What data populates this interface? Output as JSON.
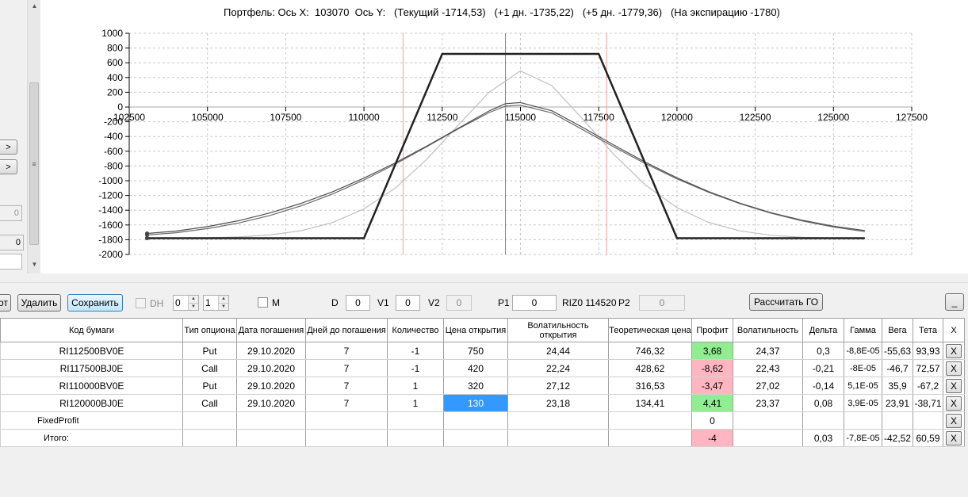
{
  "left_panel": {
    "btn1": ">",
    "btn2": ">",
    "field1": "0",
    "field2": "0",
    "scroll_grip": "≡"
  },
  "chart": {
    "title": "Портфель: Ось X:  103070  Ось Y:   (Текущий -1714,53)   (+1 дн. -1735,22)   (+5 дн. -1779,36)   (На экспирацию -1780)"
  },
  "chart_data": {
    "type": "line",
    "title": "Портфель: Ось X:  103070  Ось Y:   (Текущий -1714,53)   (+1 дн. -1735,22)   (+5 дн. -1779,36)   (На экспирацию -1780)",
    "x_ticks": [
      102500,
      105000,
      107500,
      110000,
      112500,
      115000,
      117500,
      120000,
      122500,
      125000,
      127500
    ],
    "y_ticks": [
      1000,
      800,
      600,
      400,
      200,
      0,
      -200,
      -400,
      -600,
      -800,
      -1000,
      -1200,
      -1400,
      -1600,
      -1800,
      -2000
    ],
    "xlim": [
      102500,
      127500
    ],
    "ylim": [
      -2000,
      1000
    ],
    "grid": true,
    "vertical_lines": [
      {
        "x": 111250,
        "color": "#ff9999"
      },
      {
        "x": 114520,
        "color": "#6b80c0"
      },
      {
        "x": 117750,
        "color": "#ff9999"
      }
    ],
    "series": [
      {
        "color": "#222222",
        "width": 2.5,
        "x": [
          103070,
          110000,
          112500,
          117500,
          120000,
          126000
        ],
        "y": [
          -1780,
          -1780,
          720,
          720,
          -1780,
          -1780
        ]
      },
      {
        "color": "#505050",
        "width": 1.2,
        "x": [
          103070,
          104000,
          105000,
          106000,
          107000,
          108000,
          109000,
          110000,
          111000,
          112000,
          113000,
          114000,
          114520,
          115000,
          116000,
          117000,
          118000,
          119000,
          120000,
          121000,
          122000,
          123000,
          124000,
          125000,
          126000
        ],
        "y": [
          -1715,
          -1683,
          -1623,
          -1542,
          -1437,
          -1306,
          -1149,
          -965,
          -758,
          -531,
          -293,
          -53,
          45,
          60,
          -50,
          -280,
          -520,
          -750,
          -960,
          -1145,
          -1303,
          -1433,
          -1536,
          -1616,
          -1676
        ]
      },
      {
        "color": "#6a6a6a",
        "width": 1.2,
        "x": [
          103070,
          104000,
          105000,
          106000,
          107000,
          108000,
          109000,
          110000,
          111000,
          112000,
          113000,
          114000,
          114520,
          115000,
          116000,
          117000,
          118000,
          119000,
          120000,
          121000,
          122000,
          123000,
          124000,
          125000,
          126000
        ],
        "y": [
          -1735,
          -1705,
          -1650,
          -1573,
          -1471,
          -1340,
          -1180,
          -990,
          -774,
          -540,
          -300,
          -75,
          12,
          25,
          -80,
          -310,
          -545,
          -770,
          -975,
          -1155,
          -1310,
          -1440,
          -1545,
          -1628,
          -1690
        ]
      },
      {
        "color": "#c0c0c0",
        "width": 1.2,
        "x": [
          103070,
          104000,
          105000,
          106000,
          107000,
          108000,
          109000,
          110000,
          111000,
          112000,
          113000,
          114000,
          115000,
          116000,
          117000,
          118000,
          119000,
          120000,
          121000,
          122000,
          123000,
          124000,
          125000,
          126000
        ],
        "y": [
          -1779,
          -1778,
          -1774,
          -1762,
          -1735,
          -1677,
          -1567,
          -1383,
          -1100,
          -713,
          -250,
          200,
          490,
          290,
          -170,
          -650,
          -1060,
          -1365,
          -1565,
          -1680,
          -1740,
          -1768,
          -1777,
          -1780
        ]
      }
    ]
  },
  "toolbar": {
    "btn_partial": "от",
    "delete": "Удалить",
    "save": "Сохранить",
    "dh_label": "DH",
    "spin1": "0",
    "spin2": "1",
    "m_label": "M",
    "d_label": "D",
    "d_value": "0",
    "v1_label": "V1",
    "v1_value": "0",
    "v2_label": "V2",
    "v2_value": "0",
    "p1_label": "P1",
    "p1_value": "0",
    "instrument": "RIZ0 114520",
    "p2_label": "P2",
    "p2_value": "0",
    "calc_go": "Рассчитать ГО",
    "minimize": "_"
  },
  "grid": {
    "headers": {
      "code": "Код бумаги",
      "type": "Тип опциона",
      "exp_date": "Дата погашения",
      "days": "Дней до погашения",
      "qty": "Количество",
      "open_price": "Цена открытия",
      "open_vol": "Волатильность открытия",
      "theor": "Теоретическая цена",
      "profit": "Профит",
      "vol": "Волатильность",
      "delta": "Дельта",
      "gamma": "Гамма",
      "vega": "Вега",
      "theta": "Тета",
      "x": "X"
    },
    "rows": [
      {
        "code": "RI112500BV0E",
        "type": "Put",
        "exp_date": "29.10.2020",
        "days": "7",
        "qty": "-1",
        "open_price": "750",
        "open_vol": "24,44",
        "theor": "746,32",
        "profit": "3,68",
        "vol": "24,37",
        "delta": "0,3",
        "gamma": "-8,8E-05",
        "vega": "-55,63",
        "theta": "93,93",
        "x": "X"
      },
      {
        "code": "RI117500BJ0E",
        "type": "Call",
        "exp_date": "29.10.2020",
        "days": "7",
        "qty": "-1",
        "open_price": "420",
        "open_vol": "22,24",
        "theor": "428,62",
        "profit": "-8,62",
        "vol": "22,43",
        "delta": "-0,21",
        "gamma": "-8E-05",
        "vega": "-46,7",
        "theta": "72,57",
        "x": "X"
      },
      {
        "code": "RI110000BV0E",
        "type": "Put",
        "exp_date": "29.10.2020",
        "days": "7",
        "qty": "1",
        "open_price": "320",
        "open_vol": "27,12",
        "theor": "316,53",
        "profit": "-3,47",
        "vol": "27,02",
        "delta": "-0,14",
        "gamma": "5,1E-05",
        "vega": "35,9",
        "theta": "-67,2",
        "x": "X"
      },
      {
        "code": "RI120000BJ0E",
        "type": "Call",
        "exp_date": "29.10.2020",
        "days": "7",
        "qty": "1",
        "open_price": "130",
        "open_vol": "23,18",
        "theor": "134,41",
        "profit": "4,41",
        "vol": "23,37",
        "delta": "0,08",
        "gamma": "3,9E-05",
        "vega": "23,91",
        "theta": "-38,71",
        "x": "X"
      }
    ],
    "fixed": {
      "label": "FixedProfit",
      "profit": "0",
      "x": "X"
    },
    "total": {
      "label": "Итого:",
      "profit": "-4",
      "delta": "0,03",
      "gamma": "-7,8E-05",
      "vega": "-42,52",
      "theta": "60,59",
      "x": "X"
    }
  }
}
